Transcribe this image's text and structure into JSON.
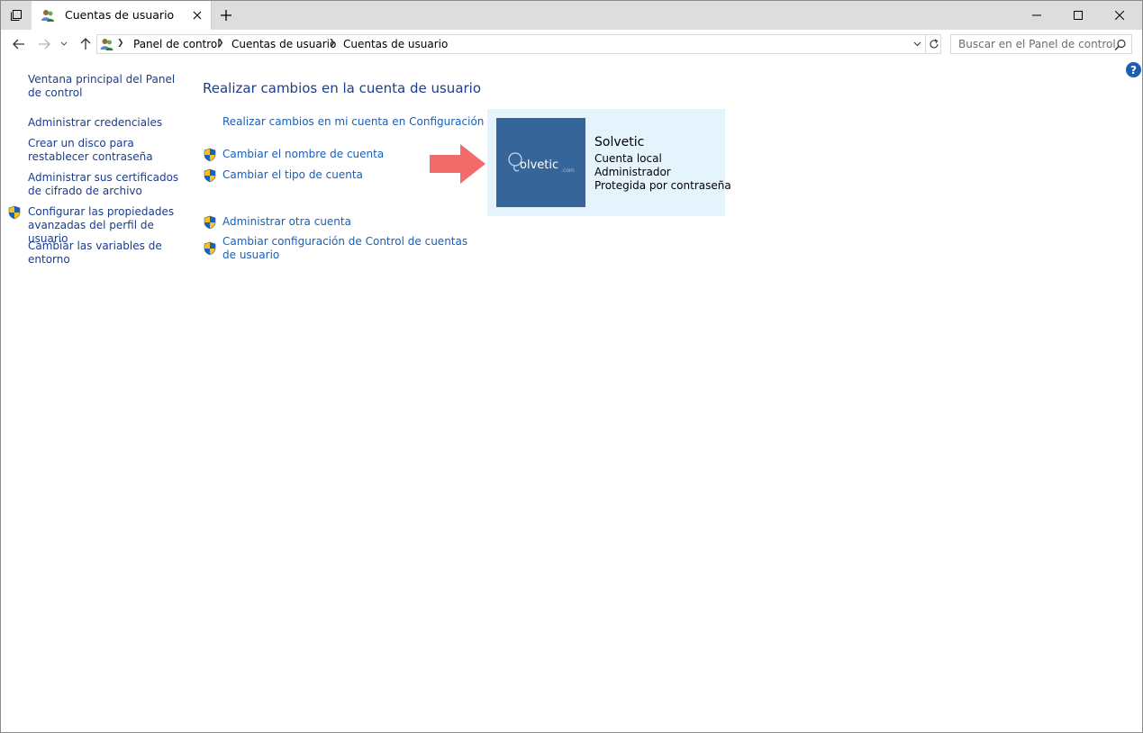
{
  "tab": {
    "title": "Cuentas de usuario"
  },
  "breadcrumb": [
    "Panel de control",
    "Cuentas de usuario",
    "Cuentas de usuario"
  ],
  "search": {
    "placeholder": "Buscar en el Panel de control"
  },
  "help": {
    "glyph": "?"
  },
  "left_links": [
    {
      "label": "Ventana principal del Panel de control",
      "shield": false
    },
    {
      "label": "Administrar credenciales",
      "shield": false
    },
    {
      "label": "Crear un disco para restablecer contraseña",
      "shield": false
    },
    {
      "label": "Administrar sus certificados de cifrado de archivo",
      "shield": false
    },
    {
      "label": "Configurar las propiedades avanzadas del perfil de usuario",
      "shield": true
    },
    {
      "label": "Cambiar las variables de entorno",
      "shield": false
    }
  ],
  "main": {
    "title": "Realizar cambios en la cuenta de usuario",
    "links": [
      {
        "label": "Realizar cambios en mi cuenta en Configuración",
        "shield": false
      },
      {
        "label": "Cambiar el nombre de cuenta",
        "shield": true
      },
      {
        "label": "Cambiar el tipo de cuenta",
        "shield": true
      },
      {
        "label": "Administrar otra cuenta",
        "shield": true
      },
      {
        "label": "Cambiar configuración de Control de cuentas de usuario",
        "shield": true
      }
    ]
  },
  "account": {
    "name": "Solvetic",
    "type": "Cuenta local",
    "role": "Administrador",
    "protection": "Protegida por contraseña",
    "logo_text": "olvetic",
    "logo_suffix": ".com"
  },
  "colors": {
    "link": "#1a5fb4",
    "heading": "#1e3e87",
    "card_bg": "#e5f3fd",
    "avatar_bg": "#366699",
    "arrow": "#f26b6b"
  }
}
